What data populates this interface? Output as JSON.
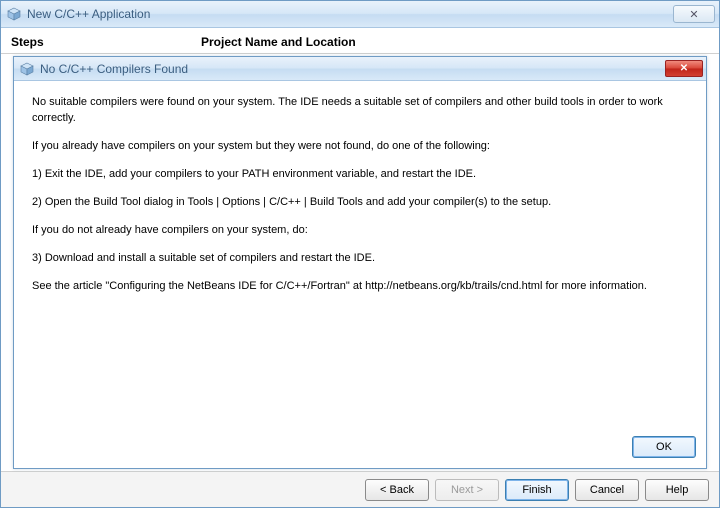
{
  "outer": {
    "title": "New C/C++ Application",
    "close_symbol": "✕"
  },
  "wizard_header": {
    "steps": "Steps",
    "location": "Project Name and Location"
  },
  "inner": {
    "title": "No C/C++ Compilers Found",
    "close_symbol": "✕",
    "p1": "No suitable compilers were found on your system. The IDE needs a suitable set of compilers and other build tools in order to work correctly.",
    "p2": "If you already have compilers on your system but they were not found, do one of the following:",
    "p3": "1) Exit the IDE, add your compilers to your PATH environment variable, and restart the IDE.",
    "p4": "2) Open the Build Tool dialog in Tools | Options | C/C++ | Build Tools and add your compiler(s) to the setup.",
    "p5": "If you do not already have compilers on your system, do:",
    "p6": "3) Download and install a suitable set of compilers and restart the IDE.",
    "p7": "See the article \"Configuring the NetBeans IDE for C/C++/Fortran\" at http://netbeans.org/kb/trails/cnd.html for more information."
  },
  "buttons": {
    "inner_ok": "OK",
    "back": "< Back",
    "next": "Next >",
    "finish": "Finish",
    "cancel": "Cancel",
    "help": "Help"
  }
}
